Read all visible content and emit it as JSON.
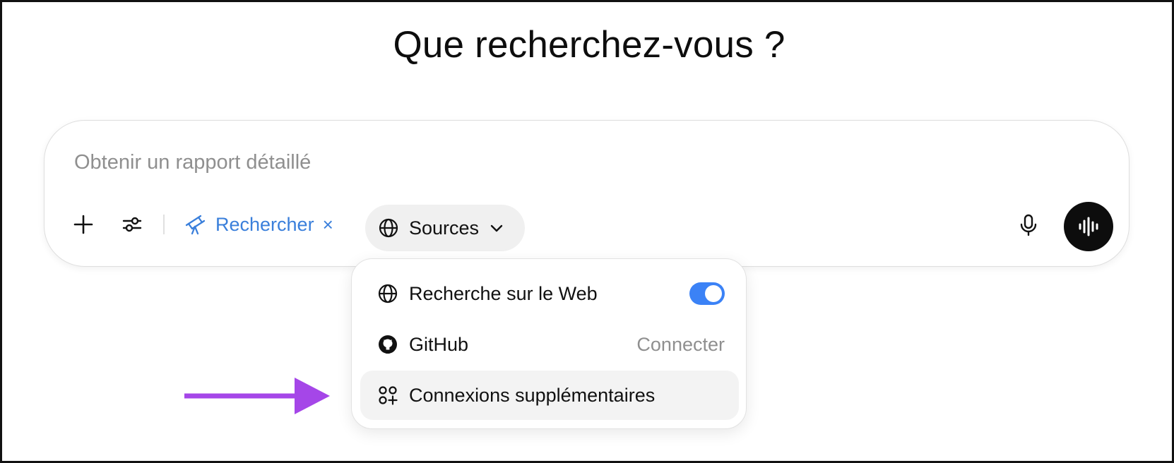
{
  "page": {
    "title": "Que recherchez-vous ?"
  },
  "composer": {
    "placeholder": "Obtenir un rapport détaillé",
    "research_chip_label": "Rechercher",
    "research_chip_close": "×",
    "sources_button_label": "Sources"
  },
  "sources_menu": {
    "items": [
      {
        "label": "Recherche sur le Web",
        "icon": "globe-icon",
        "toggle_on": true
      },
      {
        "label": "GitHub",
        "icon": "github-icon",
        "action": "Connecter"
      },
      {
        "label": "Connexions supplémentaires",
        "icon": "apps-plus-icon",
        "highlighted": true
      }
    ]
  },
  "colors": {
    "accent_blue": "#3a7fdb",
    "toggle_blue": "#3b82f6",
    "annotation_arrow": "#a546e8",
    "voice_button": "#0d0d0d"
  }
}
